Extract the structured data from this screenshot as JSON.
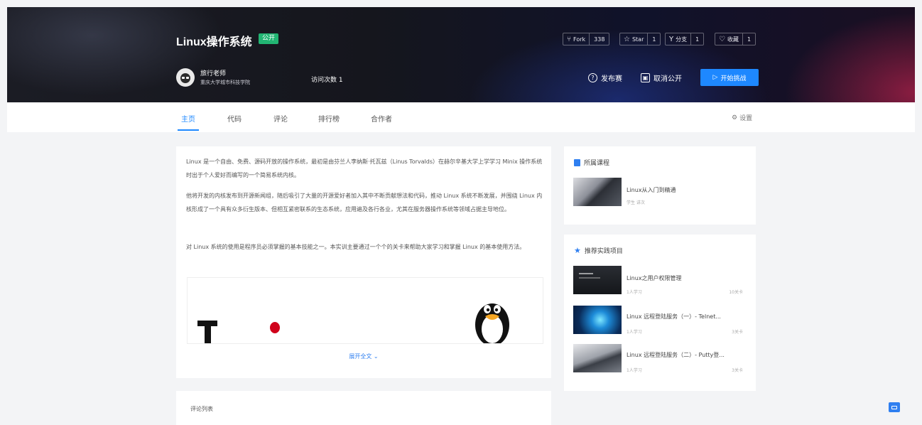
{
  "project": {
    "title": "Linux操作系统",
    "badge": "公开",
    "stats": [
      {
        "icon": "fork-icon",
        "label": "Fork",
        "count": "338"
      },
      {
        "icon": "star-icon",
        "label": "Star",
        "count": "1"
      },
      {
        "icon": "branch-icon",
        "label": "分支",
        "count": "1"
      },
      {
        "icon": "heart-icon",
        "label": "收藏",
        "count": "1"
      }
    ]
  },
  "author": {
    "name": "旅行老师",
    "org": "重庆大学城市科技学院",
    "visits": "访问次数 1"
  },
  "actions": {
    "issue": "发布赛",
    "unpublish": "取消公开",
    "start": "开始挑战"
  },
  "tabs": [
    "主页",
    "代码",
    "评论",
    "排行榜",
    "合作者"
  ],
  "settings": "设置",
  "intro": {
    "p1": "Linux 是一个自由、免费、源码开放的操作系统，最初是由芬兰人李纳斯·托瓦兹（Linus Torvalds）在赫尔辛基大学上学学习 Minix 操作系统时出于个人爱好而编写的一个简易系统内核。",
    "p2": "他将开发的内核发布到开源新闻组，随后吸引了大量的开源爱好者加入其中不断贡献想法和代码，推动 Linux 系统不断发展，并围绕 Linux 内核形成了一个具有众多衍生版本、但相互紧密联系的生态系统，应用遍及各行各业，尤其在服务器操作系统等领域占据主导地位。",
    "p3": "对 Linux 系统的使用是程序员必须掌握的基本技能之一。本实训主要通过一个个的关卡来帮助大家学习和掌握 Linux 的基本使用方法。",
    "expand": "展开全文"
  },
  "comments_title": "评论列表",
  "course_card": {
    "title": "所属课程",
    "item": {
      "title": "Linux从入门到精通",
      "meta": "学生 讲次"
    }
  },
  "recommend_card": {
    "title": "推荐实践项目",
    "items": [
      {
        "title": "Linux之用户权限管理",
        "sub": "1人学习",
        "num": "10关卡"
      },
      {
        "title": "Linux 远程登陆服务（一）- Telnet...",
        "sub": "1人学习",
        "num": "3关卡"
      },
      {
        "title": "Linux 远程登陆服务（二）- Putty登...",
        "sub": "1人学习",
        "num": "3关卡"
      }
    ]
  },
  "colors": {
    "accent": "#1e88ff",
    "badge": "#22b573",
    "penguin_beak": "#f5a623",
    "logo_dot": "#d0021b"
  }
}
